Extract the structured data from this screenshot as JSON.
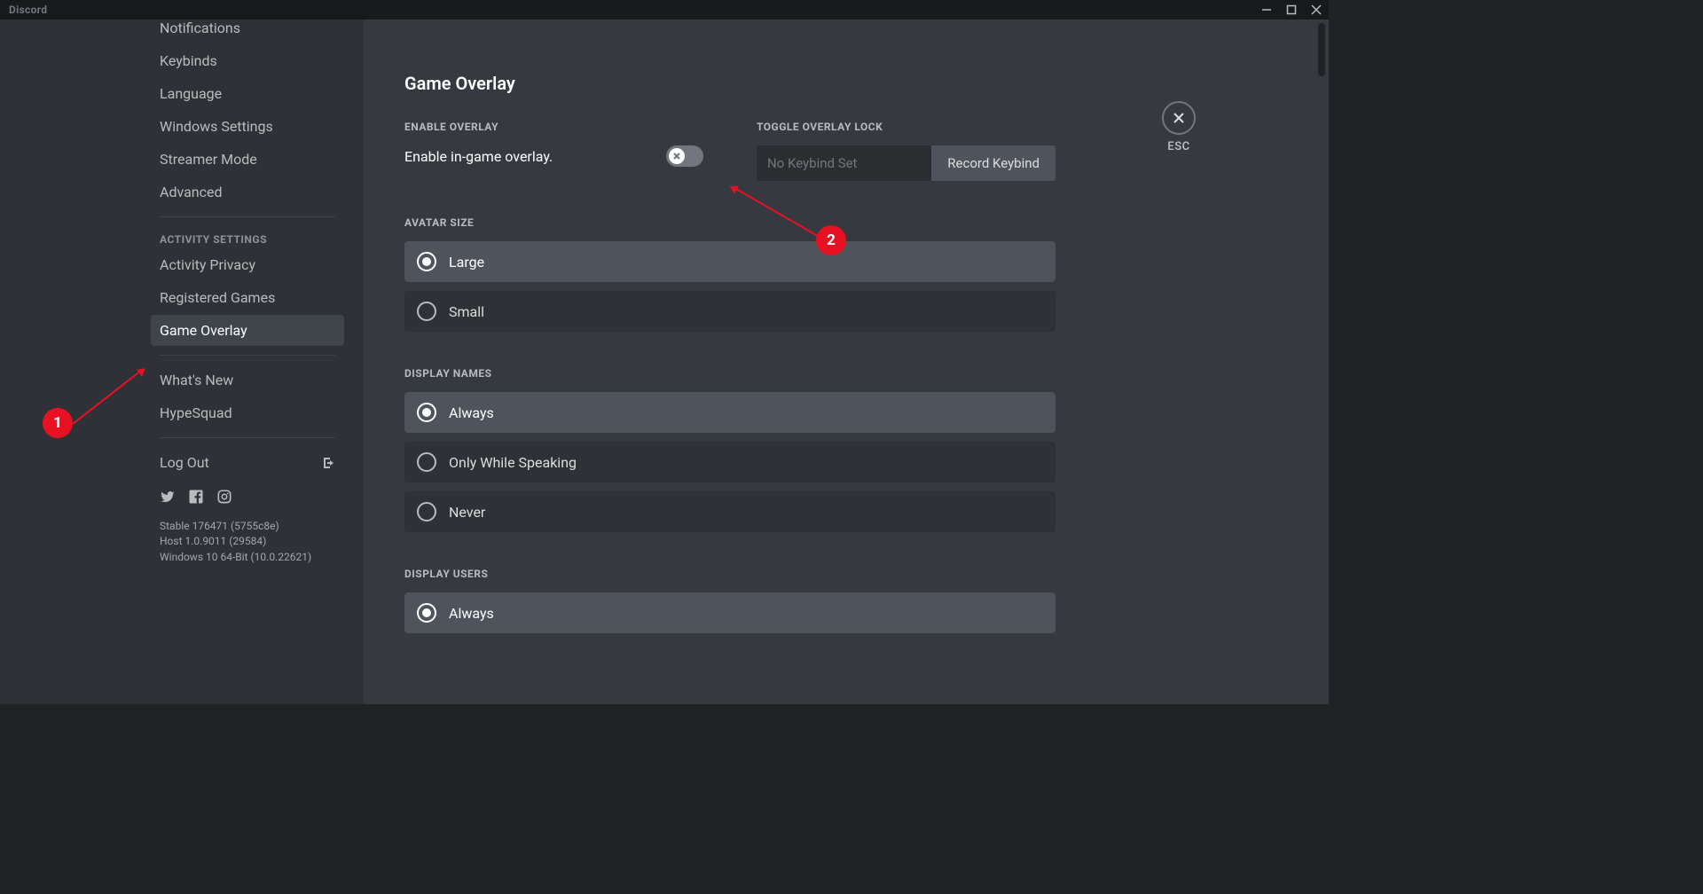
{
  "app": {
    "brand": "Discord"
  },
  "sidebar": {
    "items_partial": [
      {
        "label": "Notifications"
      },
      {
        "label": "Keybinds"
      },
      {
        "label": "Language"
      },
      {
        "label": "Windows Settings"
      },
      {
        "label": "Streamer Mode"
      },
      {
        "label": "Advanced"
      }
    ],
    "activity_header": "Activity Settings",
    "activity_items": [
      {
        "label": "Activity Privacy"
      },
      {
        "label": "Registered Games"
      },
      {
        "label": "Game Overlay",
        "selected": true
      }
    ],
    "bottom_items": [
      {
        "label": "What's New"
      },
      {
        "label": "HypeSquad"
      }
    ],
    "logout_label": "Log Out",
    "build": {
      "line1": "Stable 176471 (5755c8e)",
      "line2": "Host 1.0.9011 (29584)",
      "line3": "Windows 10 64-Bit (10.0.22621)"
    }
  },
  "content": {
    "title": "Game Overlay",
    "enable_overlay_header": "Enable Overlay",
    "enable_text": "Enable in-game overlay.",
    "toggle_lock_header": "Toggle Overlay Lock",
    "keybind_placeholder": "No Keybind Set",
    "record_btn": "Record Keybind",
    "avatar_size_header": "Avatar Size",
    "avatar_options": [
      {
        "label": "Large",
        "selected": true
      },
      {
        "label": "Small",
        "selected": false
      }
    ],
    "display_names_header": "Display Names",
    "display_names_options": [
      {
        "label": "Always",
        "selected": true
      },
      {
        "label": "Only While Speaking",
        "selected": false
      },
      {
        "label": "Never",
        "selected": false
      }
    ],
    "display_users_header": "Display Users",
    "display_users_options": [
      {
        "label": "Always",
        "selected": true
      }
    ]
  },
  "esc": {
    "label": "ESC"
  },
  "annotations": {
    "badge1": "1",
    "badge2": "2"
  }
}
